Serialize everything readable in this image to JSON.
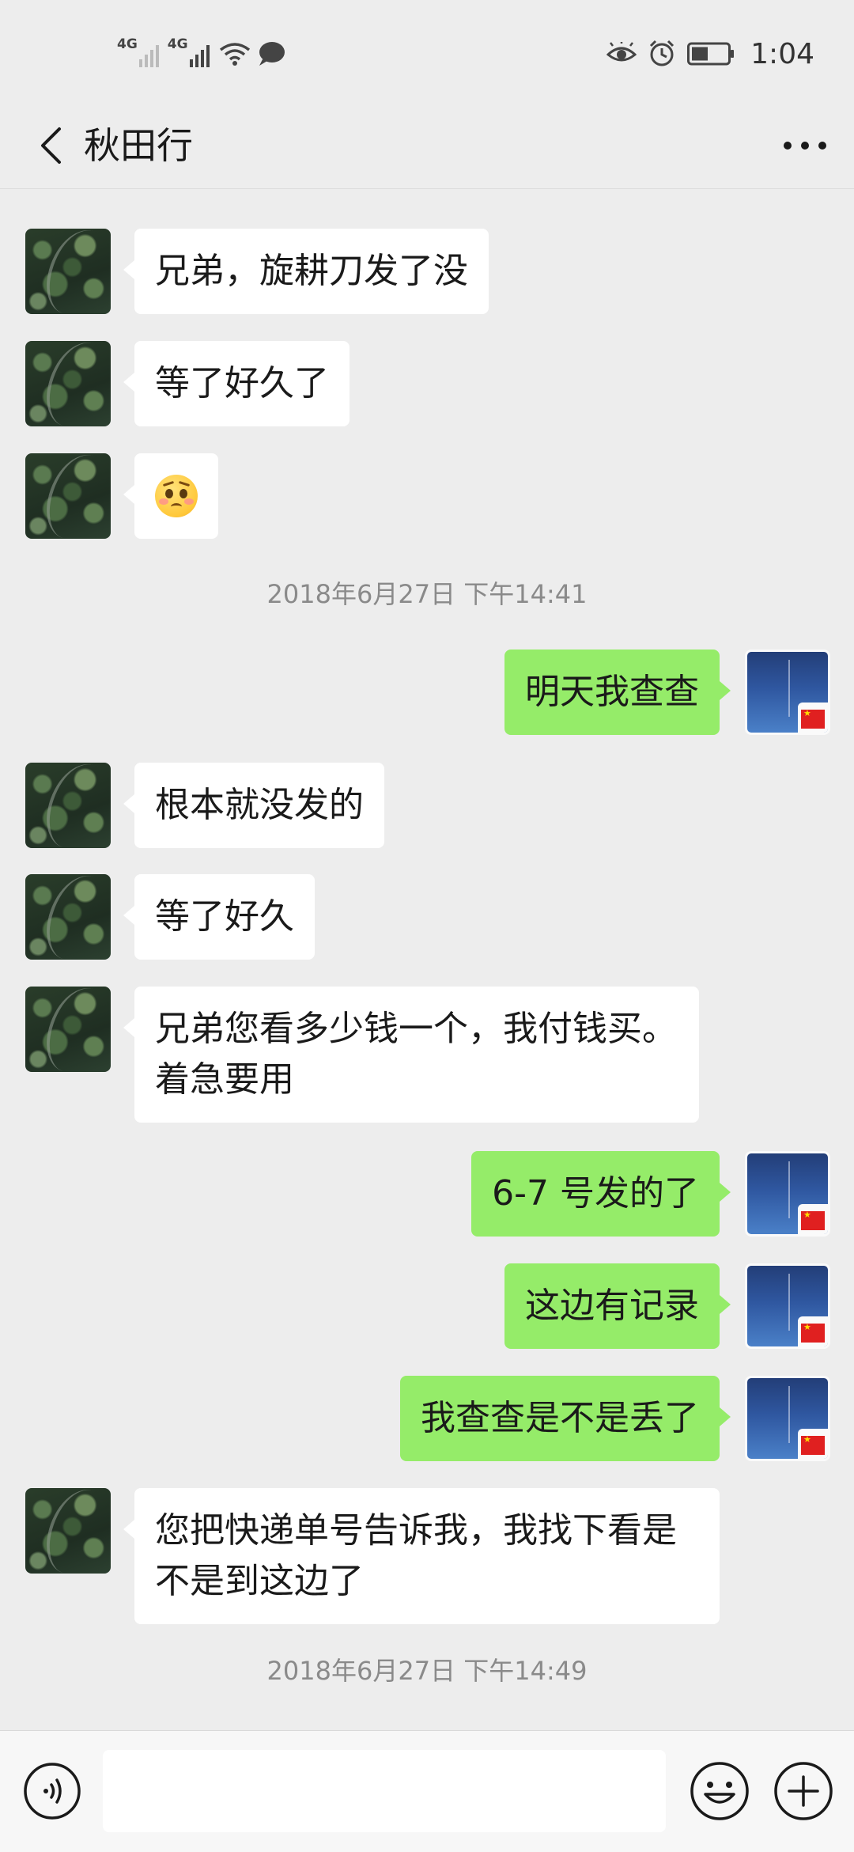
{
  "status_bar": {
    "network_1": "4G",
    "network_2": "4G",
    "time": "1:04"
  },
  "header": {
    "title": "秋田行"
  },
  "messages": [
    {
      "side": "in",
      "text": "兄弟，旋耕刀发了没"
    },
    {
      "side": "in",
      "text": "等了好久了"
    },
    {
      "side": "in",
      "emoji": "face-emoji"
    },
    {
      "timestamp": "2018年6月27日 下午14:41"
    },
    {
      "side": "out",
      "text": "明天我查查"
    },
    {
      "side": "in",
      "text": "根本就没发的"
    },
    {
      "side": "in",
      "text": "等了好久"
    },
    {
      "side": "in",
      "text": "兄弟您看多少钱一个，我付钱买。着急要用"
    },
    {
      "side": "out",
      "text": "6-7 号发的了"
    },
    {
      "side": "out",
      "text": "这边有记录"
    },
    {
      "side": "out",
      "text": "我查查是不是丢了"
    },
    {
      "side": "in",
      "text": "您把快递单号告诉我，我找下看是不是到这边了"
    },
    {
      "timestamp": "2018年6月27日 下午14:49"
    }
  ],
  "input_bar": {
    "input_value": ""
  },
  "colors": {
    "background": "#ededed",
    "incoming_bubble": "#ffffff",
    "outgoing_bubble": "#95ec69"
  }
}
